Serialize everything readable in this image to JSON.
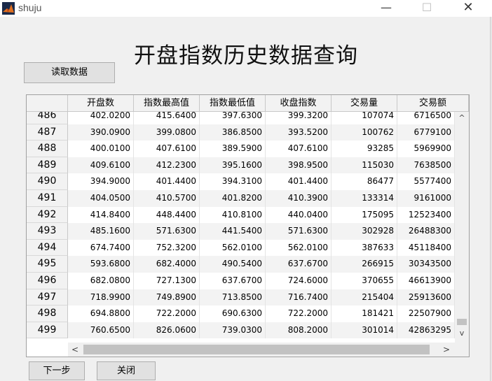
{
  "window": {
    "title": "shuju",
    "min_glyph": "—",
    "max_glyph": "☐",
    "close_glyph": "✕"
  },
  "main_title": "开盘指数历史数据查询",
  "buttons": {
    "read": "读取数据",
    "next": "下一步",
    "close": "关闭"
  },
  "table": {
    "columns": [
      "开盘数",
      "指数最高值",
      "指数最低值",
      "收盘指数",
      "交易量",
      "交易额"
    ],
    "rows": [
      {
        "id": "486",
        "cells": [
          "402.0200",
          "415.6400",
          "397.6300",
          "399.3200",
          "107074",
          "6716500"
        ]
      },
      {
        "id": "487",
        "cells": [
          "390.0900",
          "399.0800",
          "386.8500",
          "393.5200",
          "100762",
          "6779100"
        ]
      },
      {
        "id": "488",
        "cells": [
          "400.0100",
          "407.6100",
          "389.5900",
          "407.6100",
          "93285",
          "5969900"
        ]
      },
      {
        "id": "489",
        "cells": [
          "409.6100",
          "412.2300",
          "395.1600",
          "398.9500",
          "115030",
          "7638500"
        ]
      },
      {
        "id": "490",
        "cells": [
          "394.9000",
          "401.4400",
          "394.3100",
          "401.4400",
          "86477",
          "5577400"
        ]
      },
      {
        "id": "491",
        "cells": [
          "404.0500",
          "410.5700",
          "401.8200",
          "410.3900",
          "133314",
          "9161000"
        ]
      },
      {
        "id": "492",
        "cells": [
          "414.8400",
          "448.4400",
          "410.8100",
          "440.0400",
          "175095",
          "12523400"
        ]
      },
      {
        "id": "493",
        "cells": [
          "485.1600",
          "571.6300",
          "441.5400",
          "571.6300",
          "302928",
          "26488300"
        ]
      },
      {
        "id": "494",
        "cells": [
          "674.7400",
          "752.3200",
          "562.0100",
          "562.0100",
          "387633",
          "45118400"
        ]
      },
      {
        "id": "495",
        "cells": [
          "593.6800",
          "682.4000",
          "490.5400",
          "637.6700",
          "266915",
          "30343500"
        ]
      },
      {
        "id": "496",
        "cells": [
          "682.0800",
          "727.1300",
          "637.6700",
          "724.6000",
          "370655",
          "46613900"
        ]
      },
      {
        "id": "497",
        "cells": [
          "718.9900",
          "749.8900",
          "713.8500",
          "716.7400",
          "215404",
          "25913600"
        ]
      },
      {
        "id": "498",
        "cells": [
          "694.8800",
          "722.2000",
          "690.6300",
          "722.2000",
          "181421",
          "22507900"
        ]
      },
      {
        "id": "499",
        "cells": [
          "760.6500",
          "826.0600",
          "739.0300",
          "808.2000",
          "301014",
          "42863295"
        ]
      }
    ]
  },
  "scroll": {
    "up": "^",
    "down": "v",
    "left": "<",
    "right": ">"
  }
}
